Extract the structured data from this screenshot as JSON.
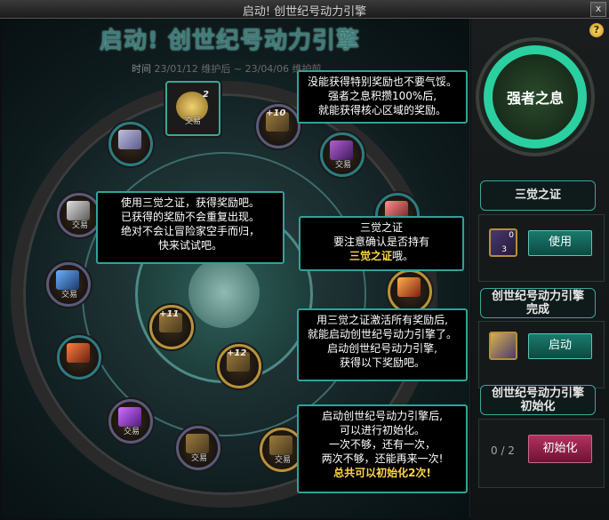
{
  "window": {
    "title": "启动! 创世纪号动力引擎",
    "close_label": "x"
  },
  "event": {
    "heading": "启动! 创世纪号动力引擎",
    "time_label": "时间",
    "time_value": "23/01/12 维护后 ~ 23/04/06 维护前"
  },
  "nodes": {
    "trade_label": "交易",
    "top_count": "2",
    "plus10": "+10",
    "plus11": "+11",
    "plus12": "+12"
  },
  "tips": {
    "core": [
      "没能获得特别奖励也不要气馁。",
      "强者之息积攒100%后,",
      "就能获得核心区域的奖励。"
    ],
    "use": [
      "使用三觉之证，获得奖励吧。",
      "已获得的奖励不会重复出现。",
      "绝对不会让冒险家空手而归，",
      "快来试试吧。"
    ],
    "proof_a": [
      "三觉之证",
      "要注意确认是否持有"
    ],
    "proof_b_highlight": "三觉之证",
    "proof_b_tail": "哦。",
    "activate": [
      "用三觉之证激活所有奖励后,",
      "就能启动创世纪号动力引擎了。",
      "启动创世纪号动力引擎,",
      "获得以下奖励吧。"
    ],
    "reset": [
      "启动创世纪号动力引擎后,",
      "可以进行初始化。",
      "一次不够，还有一次，",
      "两次不够，还能再来一次!"
    ],
    "reset_highlight": "总共可以初始化2次!"
  },
  "sidebar": {
    "help_icon": "?",
    "gauge_label": "强者之息",
    "proof": {
      "title": "三觉之证",
      "item_count": "3",
      "item_badge": "0",
      "button": "使用"
    },
    "engine_complete": {
      "title": [
        "创世纪号动力引擎",
        "完成"
      ],
      "button": "启动"
    },
    "engine_reset": {
      "title": [
        "创世纪号动力引擎",
        "初始化"
      ],
      "counter": "0 / 2",
      "button": "初始化"
    }
  },
  "colors": {
    "accent": "#2fa399",
    "highlight": "#ffd54a",
    "gauge": "#2bd0a0",
    "reset_button": "#b33060",
    "action_button": "#1a7a6d"
  }
}
